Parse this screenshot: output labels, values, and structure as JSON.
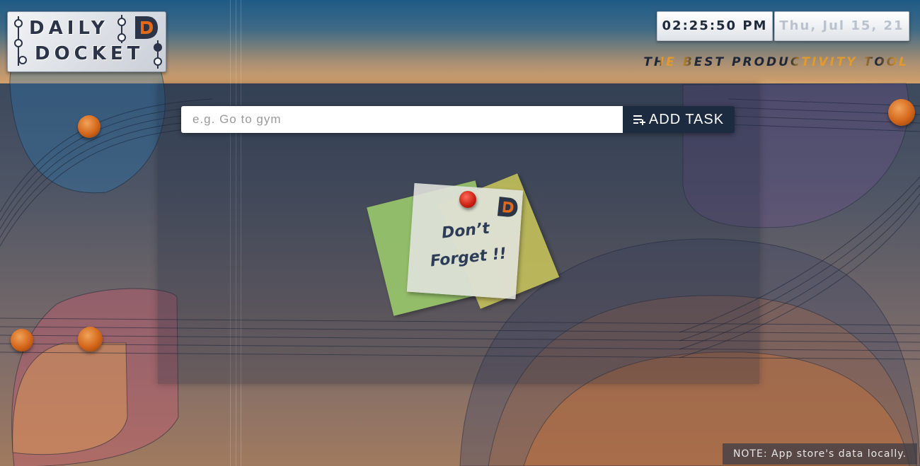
{
  "app": {
    "logo_line1": "DAILY",
    "logo_line2": "DOCKET"
  },
  "header": {
    "clock": "02:25:50 PM",
    "date": "Thu, Jul 15, 21",
    "tagline": "THE BEST PRODUCTIVITY TOOL"
  },
  "task_form": {
    "placeholder": "e.g. Go to gym",
    "value": "",
    "add_button_label": "ADD TASK",
    "add_button_icon": "playlist-add-icon"
  },
  "empty_state": {
    "line1": "Don’t",
    "line2": "Forget !!",
    "logo_icon": "d-logo-icon",
    "pin_icon": "pushpin-icon"
  },
  "footer": {
    "note": "NOTE: App store's data locally."
  },
  "colors": {
    "accent_orange": "#e39a2c",
    "dark_navy": "#1c2b40",
    "pin_red": "#c81e10"
  }
}
